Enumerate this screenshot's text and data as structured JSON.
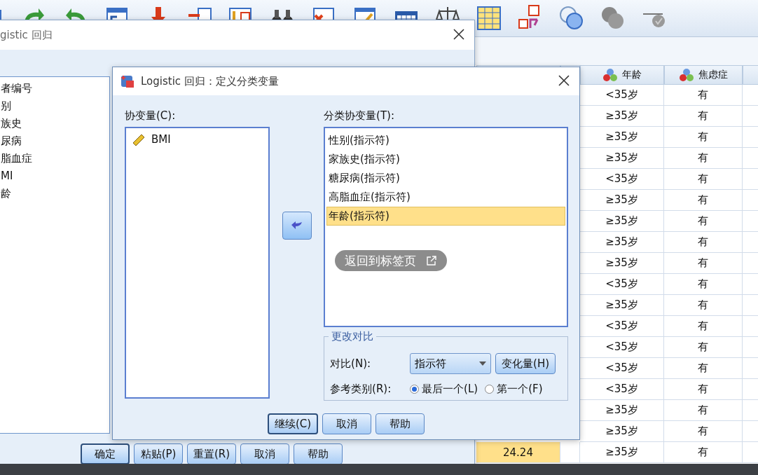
{
  "data_view": {
    "columns": [
      {
        "label": "年龄"
      },
      {
        "label": "焦虑症"
      }
    ],
    "rows": [
      {
        "age": "<35岁",
        "anxiety": "有"
      },
      {
        "age": "≥35岁",
        "anxiety": "有"
      },
      {
        "age": "≥35岁",
        "anxiety": "有"
      },
      {
        "age": "≥35岁",
        "anxiety": "有"
      },
      {
        "age": "<35岁",
        "anxiety": "有"
      },
      {
        "age": "≥35岁",
        "anxiety": "有"
      },
      {
        "age": "≥35岁",
        "anxiety": "有"
      },
      {
        "age": "≥35岁",
        "anxiety": "有"
      },
      {
        "age": "≥35岁",
        "anxiety": "有"
      },
      {
        "age": "<35岁",
        "anxiety": "有"
      },
      {
        "age": "≥35岁",
        "anxiety": "有"
      },
      {
        "age": "<35岁",
        "anxiety": "有"
      },
      {
        "age": "<35岁",
        "anxiety": "有"
      },
      {
        "age": "<35岁",
        "anxiety": "有"
      },
      {
        "age": "<35岁",
        "anxiety": "有"
      },
      {
        "age": "≥35岁",
        "anxiety": "有"
      },
      {
        "age": "≥35岁",
        "anxiety": "有"
      },
      {
        "column_1": {
          "value": "24.24",
          "selected": true
        },
        "age": "≥35岁",
        "anxiety": "有"
      }
    ]
  },
  "main_dialog": {
    "title": "gistic 回归",
    "variables": [
      {
        "name": "者编号"
      },
      {
        "name": "别"
      },
      {
        "name": "族史"
      },
      {
        "name": "尿病"
      },
      {
        "name": "脂血症"
      },
      {
        "name": "MI"
      },
      {
        "name": "龄"
      }
    ],
    "buttons": [
      {
        "label": "确定",
        "default": true
      },
      {
        "label": "粘贴(P)",
        "default": false
      },
      {
        "label": "重置(R)",
        "default": false
      },
      {
        "label": "取消",
        "default": false
      },
      {
        "label": "帮助",
        "default": false
      }
    ]
  },
  "sub_dialog": {
    "title": "Logistic 回归：定义分类变量",
    "covariates_label": "协变量(C):",
    "covariates": [
      {
        "name": "BMI"
      }
    ],
    "categorical_label": "分类协变量(T):",
    "categorical": [
      {
        "label": "性别(指示符)",
        "selected": false
      },
      {
        "label": "家族史(指示符)",
        "selected": false
      },
      {
        "label": "糖尿病(指示符)",
        "selected": false
      },
      {
        "label": "高脂血症(指示符)",
        "selected": false
      },
      {
        "label": "年龄(指示符)",
        "selected": true
      }
    ],
    "contrast_group": {
      "title": "更改对比",
      "contrast_label": "对比(N):",
      "contrast_value": "指示符",
      "change_button": "变化量(H)",
      "reference_label": "参考类别(R):",
      "reference_options": [
        {
          "label": "最后一个(L)",
          "selected": true
        },
        {
          "label": "第一个(F)",
          "selected": false
        }
      ]
    },
    "buttons": [
      {
        "label": "继续(C)",
        "default": true
      },
      {
        "label": "取消",
        "default": false
      },
      {
        "label": "帮助",
        "default": false
      }
    ]
  },
  "overlay": {
    "label": "返回到标签页"
  }
}
